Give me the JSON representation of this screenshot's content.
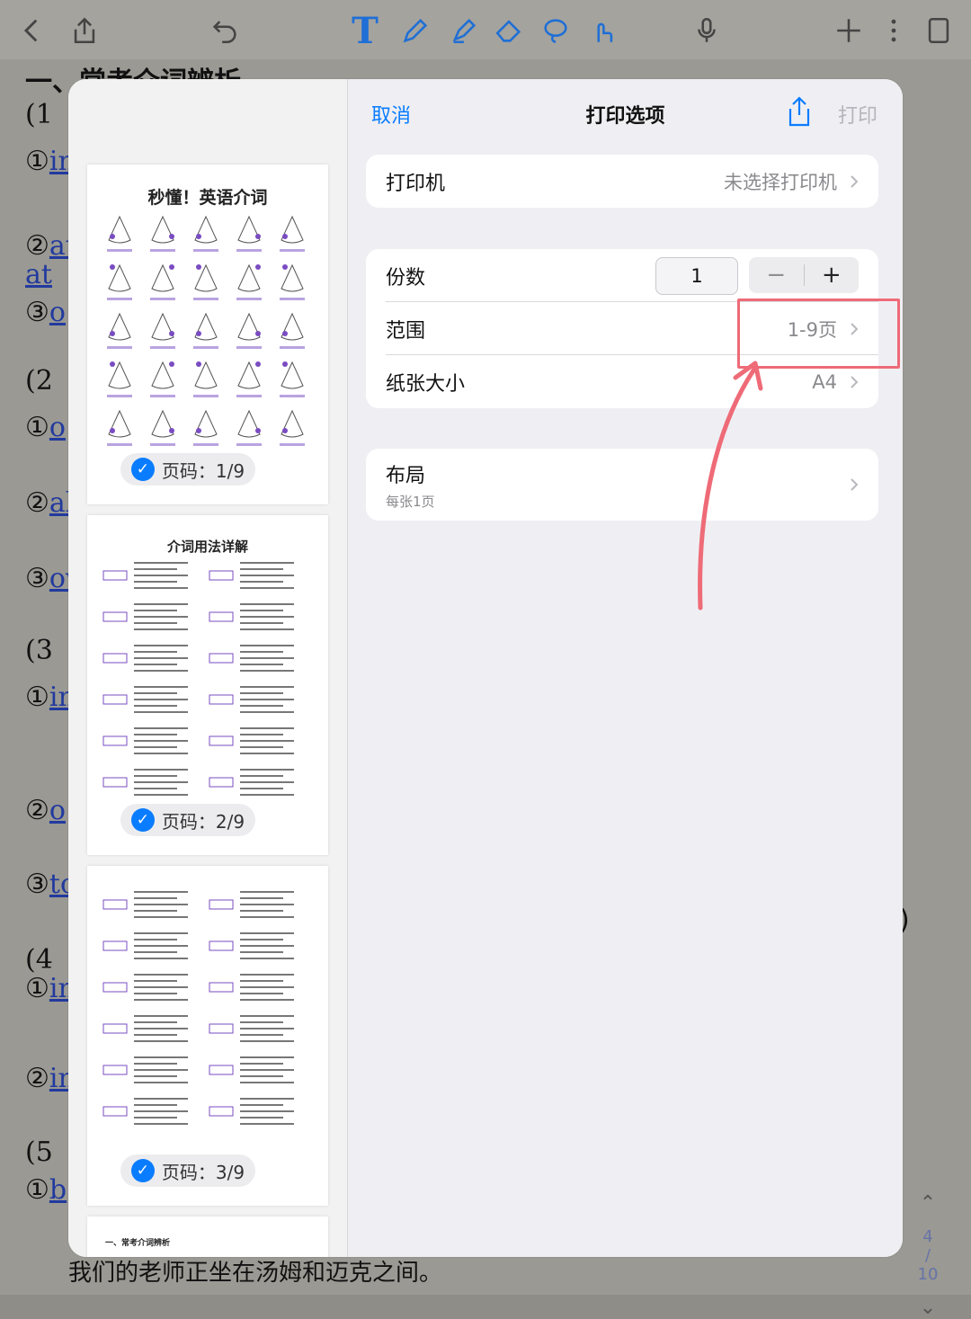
{
  "toolbar": {
    "icons": [
      "back-icon",
      "share-icon",
      "undo-icon",
      "text-tool-icon",
      "pen-icon",
      "highlighter-icon",
      "eraser-icon",
      "lasso-icon",
      "finger-icon",
      "microphone-icon",
      "plus-icon",
      "more-icon",
      "pages-icon"
    ],
    "text_tool_glyph": "T"
  },
  "doc": {
    "heading": "一、常考介词辨析",
    "lines": [
      {
        "num": "(1",
        "text": ""
      },
      {
        "num": "①",
        "text": "in"
      },
      {
        "num": "②",
        "text": "at"
      },
      {
        "num": "",
        "text": "at"
      },
      {
        "num": "③",
        "text": "o"
      },
      {
        "num": "(2",
        "text": ""
      },
      {
        "num": "①",
        "text": "o"
      },
      {
        "num": "②",
        "text": "al"
      },
      {
        "num": "③",
        "text": "ov"
      },
      {
        "num": "(3",
        "text": ""
      },
      {
        "num": "①",
        "text": "in"
      },
      {
        "num": "②",
        "text": "o"
      },
      {
        "num": "③",
        "text": "to"
      },
      {
        "num": "(4",
        "text": ""
      },
      {
        "num": "①",
        "text": "in"
      },
      {
        "num": "②",
        "text": "in"
      },
      {
        "num": "(5",
        "text": ""
      },
      {
        "num": "①",
        "text": "b"
      }
    ],
    "right_paren": ")",
    "bottom_sentence": "我们的老师正坐在汤姆和迈克之间。",
    "page_current": "4",
    "page_sep": "/",
    "page_total": "10"
  },
  "modal": {
    "cancel": "取消",
    "title": "打印选项",
    "print": "打印",
    "thumbnails": [
      {
        "title": "秒懂！英语介词",
        "badge": "页码：1/9"
      },
      {
        "title": "介词用法详解",
        "badge": "页码：2/9"
      },
      {
        "title": "",
        "badge": "页码：3/9"
      },
      {
        "title": "一、常考介词辨析",
        "badge": ""
      }
    ],
    "printer": {
      "label": "打印机",
      "value": "未选择打印机"
    },
    "copies": {
      "label": "份数",
      "value": "1",
      "minus": "−",
      "plus": "+"
    },
    "range": {
      "label": "范围",
      "value": "1-9页"
    },
    "paper": {
      "label": "纸张大小",
      "value": "A4"
    },
    "layout": {
      "label": "布局",
      "sub": "每张1页"
    }
  },
  "colors": {
    "accent": "#0a7cff",
    "annotation": "#ee6b77",
    "purple": "#7a4cc2"
  }
}
